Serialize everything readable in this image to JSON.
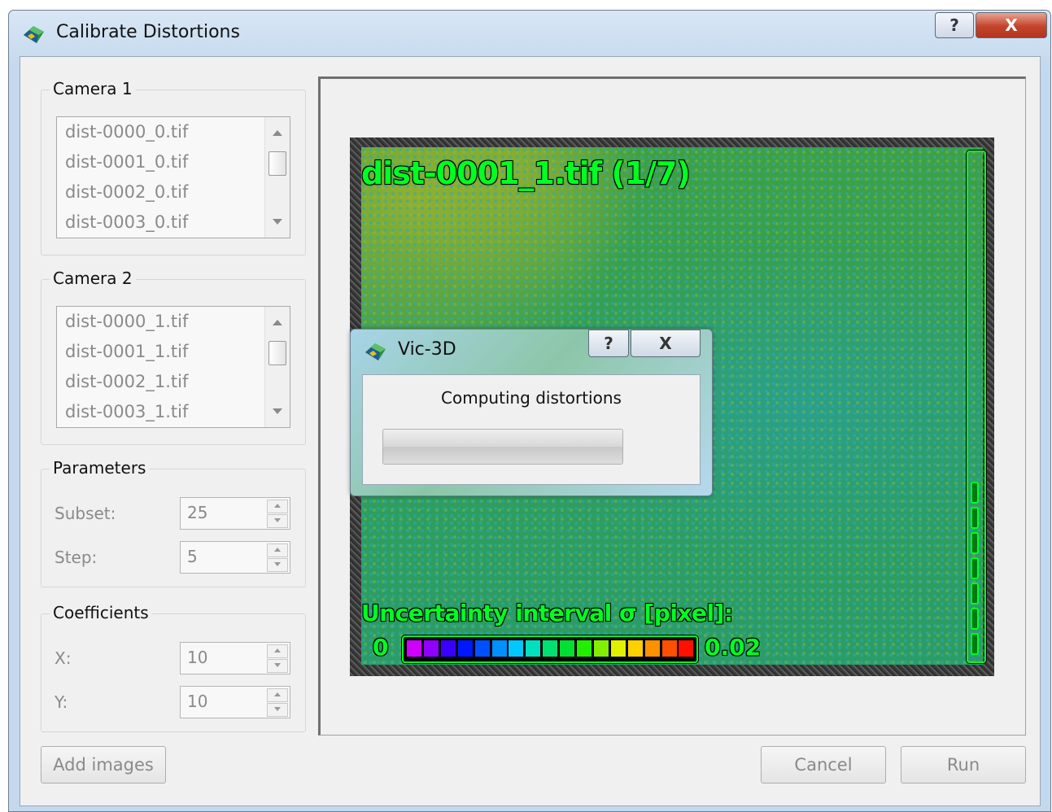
{
  "window": {
    "title": "Calibrate Distortions",
    "help_glyph": "?",
    "close_glyph": "X"
  },
  "camera1": {
    "title": "Camera 1",
    "items": [
      "dist-0000_0.tif",
      "dist-0001_0.tif",
      "dist-0002_0.tif",
      "dist-0003_0.tif"
    ]
  },
  "camera2": {
    "title": "Camera 2",
    "items": [
      "dist-0000_1.tif",
      "dist-0001_1.tif",
      "dist-0002_1.tif",
      "dist-0003_1.tif"
    ]
  },
  "parameters": {
    "title": "Parameters",
    "subset_label": "Subset:",
    "subset_value": "25",
    "step_label": "Step:",
    "step_value": "5"
  },
  "coefficients": {
    "title": "Coefficients",
    "x_label": "X:",
    "x_value": "10",
    "y_label": "Y:",
    "y_value": "10"
  },
  "buttons": {
    "add_images": "Add images",
    "cancel": "Cancel",
    "run": "Run"
  },
  "viewer": {
    "image_label": "dist-0001_1.tif (1/7)",
    "legend_title": "Uncertainty interval σ [pixel]:",
    "legend_min": "0",
    "legend_max": "0.02",
    "colormap": [
      "#d000ff",
      "#9000ff",
      "#3a00ff",
      "#0018ff",
      "#0050ff",
      "#0090ff",
      "#00c8ff",
      "#00e0c0",
      "#00e070",
      "#00e030",
      "#20f000",
      "#80f000",
      "#e0f000",
      "#ffd000",
      "#ff9000",
      "#ff5000",
      "#ff1000"
    ],
    "level_bar_filled_segments": 7,
    "level_bar_total_segments": 20
  },
  "progress_dialog": {
    "title": "Vic-3D",
    "message": "Computing distortions",
    "help_glyph": "?",
    "close_glyph": "X",
    "progress_fraction": 0.0
  },
  "colors": {
    "overlay_green": "#00ff22",
    "disabled_text": "#8a8a8a",
    "close_red": "#c4432b"
  }
}
